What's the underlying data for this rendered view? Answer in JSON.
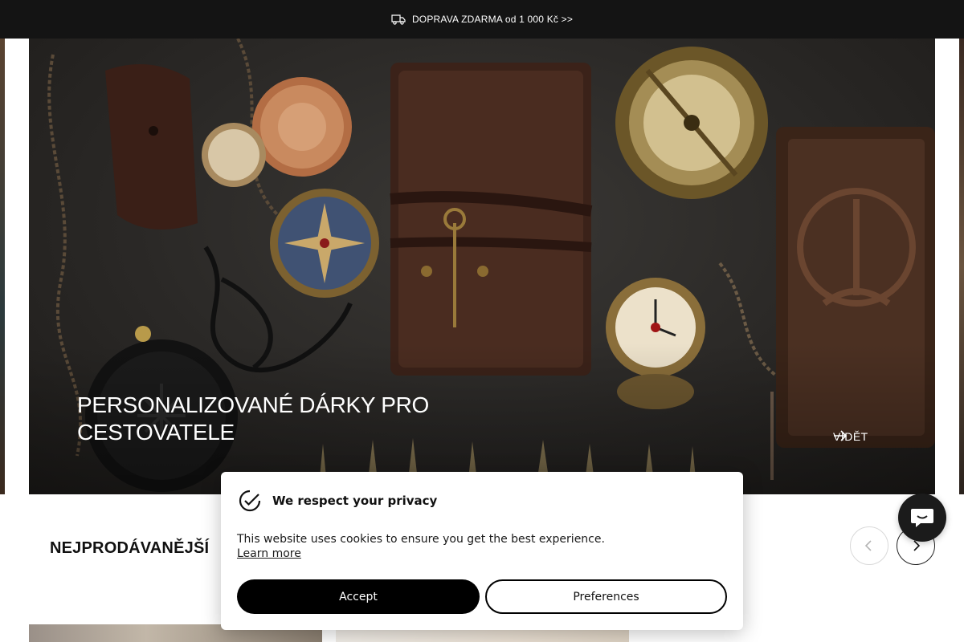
{
  "announcement": {
    "text": "DOPRAVA ZDARMA od 1 000 Kč >>",
    "icon": "truck-icon"
  },
  "hero": {
    "title": "PERSONALIZOVANÉ DÁRKY PRO CESTOVATELE",
    "cta_label": "VIDĚT",
    "cta_icon": "arrow-right-icon"
  },
  "bestsellers": {
    "title": "NEJPRODÁVANĚJŠÍ",
    "prev_icon": "chevron-left-icon",
    "next_icon": "chevron-right-icon"
  },
  "cookie": {
    "title": "We respect your privacy",
    "text": "This website uses cookies to ensure you get the best experience.",
    "learn_more": "Learn more",
    "accept_label": "Accept",
    "preferences_label": "Preferences"
  },
  "chat": {
    "icon": "chat-icon"
  },
  "colors": {
    "announcement_bg": "#141414",
    "accent": "#000000",
    "button_text": "#ffffff"
  }
}
